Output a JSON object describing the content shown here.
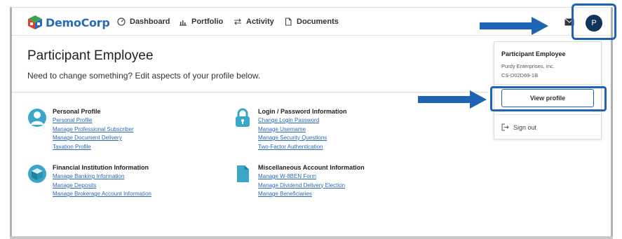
{
  "brand": {
    "name": "DemoCorp"
  },
  "nav": [
    {
      "label": "Dashboard",
      "icon": "dashboard-icon"
    },
    {
      "label": "Portfolio",
      "icon": "chart-icon"
    },
    {
      "label": "Activity",
      "icon": "transfer-arrows-icon"
    },
    {
      "label": "Documents",
      "icon": "document-icon"
    }
  ],
  "user": {
    "initial": "P"
  },
  "page": {
    "title": "Participant Employee",
    "subtitle": "Need to change something? Edit aspects of your profile below."
  },
  "sections": {
    "personal": {
      "title": "Personal Profile",
      "links": [
        "Personal Profile",
        "Manage Professional Subscriber",
        "Manage Document Delivery",
        "Taxation Profile"
      ]
    },
    "login": {
      "title": "Login / Password Information",
      "links": [
        "Change Login Password",
        "Manage Username",
        "Manage Security Questions",
        "Two-Factor Authentication"
      ]
    },
    "financial": {
      "title": "Financial Institution Information",
      "links": [
        "Manage Banking Information",
        "Manage Deposits",
        "Manage Brokerage Account Information"
      ]
    },
    "misc": {
      "title": "Miscellaneous Account Information",
      "links": [
        "Manage W-8BEN Form",
        "Manage Dividend Delivery Election",
        "Manage Beneficiaries"
      ]
    }
  },
  "dropdown": {
    "name": "Participant Employee",
    "company": "Purdy Enterprises, Inc.",
    "account_id": "CS-D02D69-1B",
    "view_profile": "View profile",
    "sign_out": "Sign out"
  },
  "colors": {
    "accent": "#2a6bb8",
    "highlight": "#1f63b3",
    "avatar": "#12335a",
    "icon_teal": "#3aa6c8"
  }
}
